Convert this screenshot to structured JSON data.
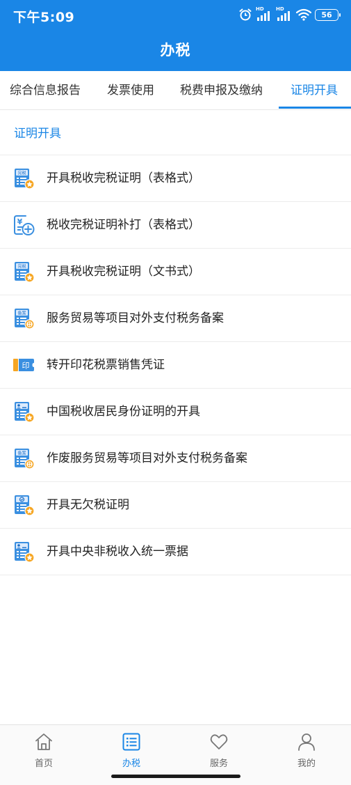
{
  "status_bar": {
    "time": "下午5:09",
    "hd1": "HD",
    "hd2": "HD",
    "battery": "56"
  },
  "header": {
    "title": "办税"
  },
  "tabs": [
    {
      "label": "综合信息报告",
      "active": false
    },
    {
      "label": "发票使用",
      "active": false
    },
    {
      "label": "税费申报及缴纳",
      "active": false
    },
    {
      "label": "证明开具",
      "active": true
    }
  ],
  "section": {
    "title": "证明开具"
  },
  "items": [
    {
      "label": "开具税收完税证明（表格式）",
      "icon": "wanshui-certificate-icon",
      "badge": "完税"
    },
    {
      "label": "税收完税证明补打（表格式）",
      "icon": "yuan-add-icon",
      "badge": "¥"
    },
    {
      "label": "开具税收完税证明（文书式）",
      "icon": "wanshui-certificate-icon",
      "badge": "完税"
    },
    {
      "label": "服务贸易等项目对外支付税务备案",
      "icon": "beian-globe-icon",
      "badge": "备案"
    },
    {
      "label": "转开印花税票销售凭证",
      "icon": "stamp-ticket-icon",
      "badge": "印"
    },
    {
      "label": "中国税收居民身份证明的开具",
      "icon": "resident-identity-icon",
      "badge": ""
    },
    {
      "label": "作废服务贸易等项目对外支付税务备案",
      "icon": "beian-globe-icon",
      "badge": "备案"
    },
    {
      "label": "开具无欠税证明",
      "icon": "no-arrears-icon",
      "badge": ""
    },
    {
      "label": "开具中央非税收入统一票据",
      "icon": "central-receipt-icon",
      "badge": ""
    }
  ],
  "bottom_nav": [
    {
      "label": "首页",
      "icon": "home-icon",
      "active": false
    },
    {
      "label": "办税",
      "icon": "list-icon",
      "active": true
    },
    {
      "label": "服务",
      "icon": "heart-icon",
      "active": false
    },
    {
      "label": "我的",
      "icon": "person-icon",
      "active": false
    }
  ],
  "colors": {
    "primary": "#1a86e6",
    "accent": "#f6a623"
  }
}
